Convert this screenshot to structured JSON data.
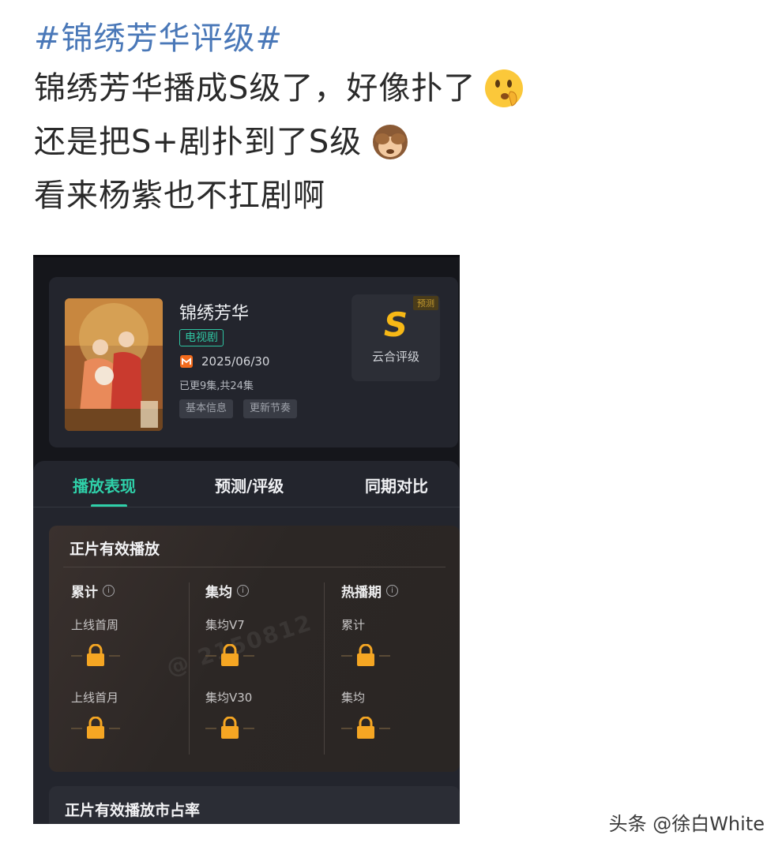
{
  "post": {
    "hashtag": "#锦绣芳华评级#",
    "lines": [
      "锦绣芳华播成S级了，好像扑了",
      "还是把S+剧扑到了S级",
      "看来杨紫也不扛剧啊"
    ],
    "emojis": [
      "shushing-face-emoji",
      "see-no-evil-monkey-emoji"
    ]
  },
  "screenshot": {
    "show": {
      "title": "锦绣芳华",
      "type_tag": "电视剧",
      "platform_icon": "mango-tv-icon",
      "date": "2025/06/30",
      "episodes": "已更9集,共24集",
      "chips": [
        "基本信息",
        "更新节奏"
      ]
    },
    "grade": {
      "tag": "预测",
      "letter": "S",
      "label": "云合评级"
    },
    "tabs": [
      {
        "label": "播放表现",
        "active": true
      },
      {
        "label": "预测/评级",
        "active": false
      },
      {
        "label": "同期对比",
        "active": false
      }
    ],
    "panel": {
      "title": "正片有效播放",
      "columns": [
        {
          "head": "累计",
          "metrics": [
            "上线首周",
            "上线首月"
          ]
        },
        {
          "head": "集均",
          "metrics": [
            "集均V7",
            "集均V30"
          ]
        },
        {
          "head": "热播期",
          "metrics": [
            "累计",
            "集均"
          ]
        }
      ],
      "watermark": "@ 2150812"
    },
    "panel2": {
      "title": "正片有效播放市占率"
    }
  },
  "footer": {
    "source": "头条 @徐白White"
  },
  "colors": {
    "hashtag": "#4a78b8",
    "accent_green": "#2fd0a9",
    "grade_gold": "#f7b816",
    "lock": "#f5a623"
  }
}
